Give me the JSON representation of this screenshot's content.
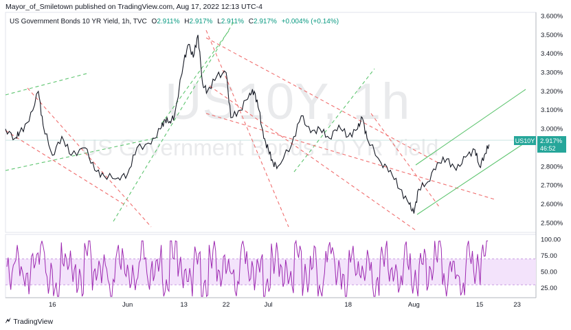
{
  "header": {
    "publisher": "Mayor_of_Smiletown published on TradingView.com, Aug 17, 2022 12:13 UTC-4"
  },
  "legend": {
    "symbol": "US Government Bonds 10 YR Yield, 1h, TVC",
    "open_label": "O",
    "open": "2.911%",
    "high_label": "H",
    "high": "2.917%",
    "low_label": "L",
    "low": "2.911%",
    "close_label": "C",
    "close": "2.917%",
    "change": "+0.004% (+0.14%)"
  },
  "watermark": {
    "ticker": "US10Y, 1h",
    "name": "US Government Bonds 10 YR Yield"
  },
  "price_label": {
    "ticker": "US10Y",
    "price": "2.917%",
    "countdown": "46:52"
  },
  "footer": {
    "brand": "TradingView"
  },
  "colors": {
    "series": "#131722",
    "up_channel": "#5cc46e",
    "down_trend": "#f06e6e",
    "rsi_line": "#9c27b0",
    "rsi_band": "#f3e3fb",
    "price_badge": "#26a69a"
  },
  "chart_data": [
    {
      "type": "line",
      "ylim": [
        2.45,
        3.62
      ],
      "ytick_labels": [
        "3.600%",
        "3.500%",
        "3.400%",
        "3.300%",
        "3.200%",
        "3.100%",
        "3.000%",
        "2.900%",
        "2.800%",
        "2.700%",
        "2.600%",
        "2.500%"
      ],
      "yticks": [
        3.6,
        3.5,
        3.4,
        3.3,
        3.2,
        3.1,
        3.0,
        2.9,
        2.8,
        2.7,
        2.6,
        2.5
      ],
      "xlim": [
        "2022-05-06",
        "2022-08-27"
      ],
      "xticks": [
        "2022-05-16",
        "2022-06-01",
        "2022-06-13",
        "2022-06-22",
        "2022-07-01",
        "2022-07-18",
        "2022-08-01",
        "2022-08-15",
        "2022-08-23"
      ],
      "xtick_labels": [
        "16",
        "Jun",
        "13",
        "22",
        "Jul",
        "18",
        "Aug",
        "15",
        "23"
      ],
      "grid": false,
      "x": [
        "2022-05-06",
        "2022-05-08",
        "2022-05-09",
        "2022-05-11",
        "2022-05-13",
        "2022-05-14",
        "2022-05-16",
        "2022-05-18",
        "2022-05-20",
        "2022-05-23",
        "2022-05-25",
        "2022-05-27",
        "2022-05-30",
        "2022-06-01",
        "2022-06-03",
        "2022-06-06",
        "2022-06-08",
        "2022-06-09",
        "2022-06-10",
        "2022-06-11",
        "2022-06-13",
        "2022-06-14",
        "2022-06-15",
        "2022-06-16",
        "2022-06-17",
        "2022-06-18",
        "2022-06-20",
        "2022-06-22",
        "2022-06-23",
        "2022-06-25",
        "2022-06-27",
        "2022-06-28",
        "2022-06-29",
        "2022-06-30",
        "2022-07-01",
        "2022-07-02",
        "2022-07-03",
        "2022-07-06",
        "2022-07-08",
        "2022-07-10",
        "2022-07-12",
        "2022-07-14",
        "2022-07-16",
        "2022-07-18",
        "2022-07-20",
        "2022-07-21",
        "2022-07-22",
        "2022-07-25",
        "2022-07-27",
        "2022-07-29",
        "2022-07-31",
        "2022-08-01",
        "2022-08-02",
        "2022-08-04",
        "2022-08-06",
        "2022-08-08",
        "2022-08-10",
        "2022-08-12",
        "2022-08-14",
        "2022-08-15",
        "2022-08-16",
        "2022-08-17"
      ],
      "values": [
        3.0,
        2.95,
        2.98,
        3.04,
        3.2,
        3.02,
        2.86,
        2.96,
        2.86,
        2.9,
        2.78,
        2.75,
        2.74,
        2.76,
        2.9,
        2.92,
        3.0,
        3.05,
        3.04,
        3.07,
        3.36,
        3.45,
        3.38,
        3.5,
        3.24,
        3.2,
        3.28,
        3.3,
        3.06,
        3.1,
        3.19,
        3.2,
        3.1,
        2.95,
        2.89,
        2.82,
        2.8,
        2.92,
        3.07,
        2.98,
        3.0,
        2.95,
        3.02,
        2.96,
        3.0,
        3.06,
        2.95,
        2.82,
        2.78,
        2.68,
        2.6,
        2.55,
        2.68,
        2.72,
        2.82,
        2.84,
        2.78,
        2.85,
        2.89,
        2.8,
        2.86,
        2.917
      ],
      "series": [
        {
          "name": "US Government Bonds 10 YR Yield",
          "values": []
        }
      ]
    },
    {
      "type": "line",
      "ylim": [
        10,
        108
      ],
      "yticks": [
        100,
        75,
        50,
        25
      ],
      "ytick_labels": [
        "100.00",
        "75.00",
        "50.00",
        "25.00"
      ],
      "band": [
        30,
        70
      ],
      "values": [
        48,
        70,
        35,
        62,
        88,
        40,
        25,
        72,
        55,
        30,
        85,
        45,
        60,
        22,
        78,
        50,
        35,
        82,
        40,
        65,
        28,
        90,
        52,
        38,
        70,
        18,
        80,
        48,
        62,
        30,
        86,
        44,
        58,
        25,
        75,
        50,
        40,
        83,
        35,
        68,
        22,
        88,
        55,
        30,
        72,
        46,
        62,
        20,
        80,
        52,
        36,
        74,
        28,
        66,
        45,
        90,
        33,
        60,
        24,
        78,
        50,
        84
      ]
    }
  ]
}
